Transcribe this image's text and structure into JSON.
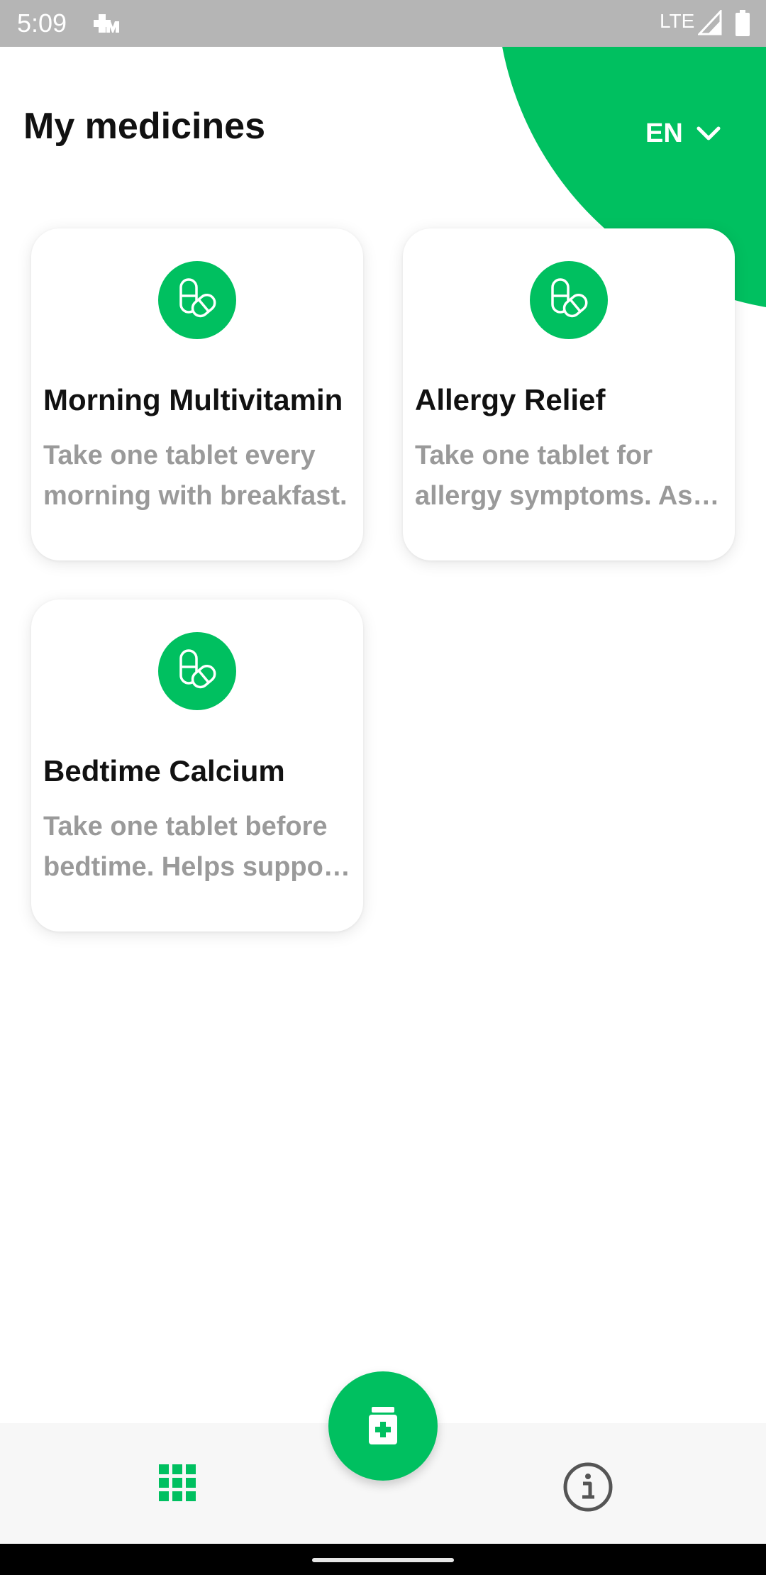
{
  "status_bar": {
    "time": "5:09",
    "network": "LTE",
    "notification_icon": "medical-cross-icon",
    "signal_icon": "signal-icon",
    "battery_icon": "battery-icon"
  },
  "header": {
    "title": "My medicines",
    "language": "EN"
  },
  "medicines": [
    {
      "title": "Morning Multivitamin",
      "description": "Take one tablet every morning with breakfast.",
      "icon": "pills-icon"
    },
    {
      "title": "Allergy Relief",
      "description": "Take one tablet for allergy symptoms. As needed.",
      "icon": "pills-icon"
    },
    {
      "title": "Bedtime Calcium",
      "description": "Take one tablet before bedtime. Helps support bones.",
      "icon": "pills-icon"
    }
  ],
  "bottom_nav": {
    "left_icon": "grid-icon",
    "fab_icon": "add-medicine-icon",
    "right_icon": "info-icon"
  },
  "colors": {
    "accent": "#00c060",
    "muted_text": "#9a9a9a",
    "status_bar": "#b5b5b5"
  }
}
